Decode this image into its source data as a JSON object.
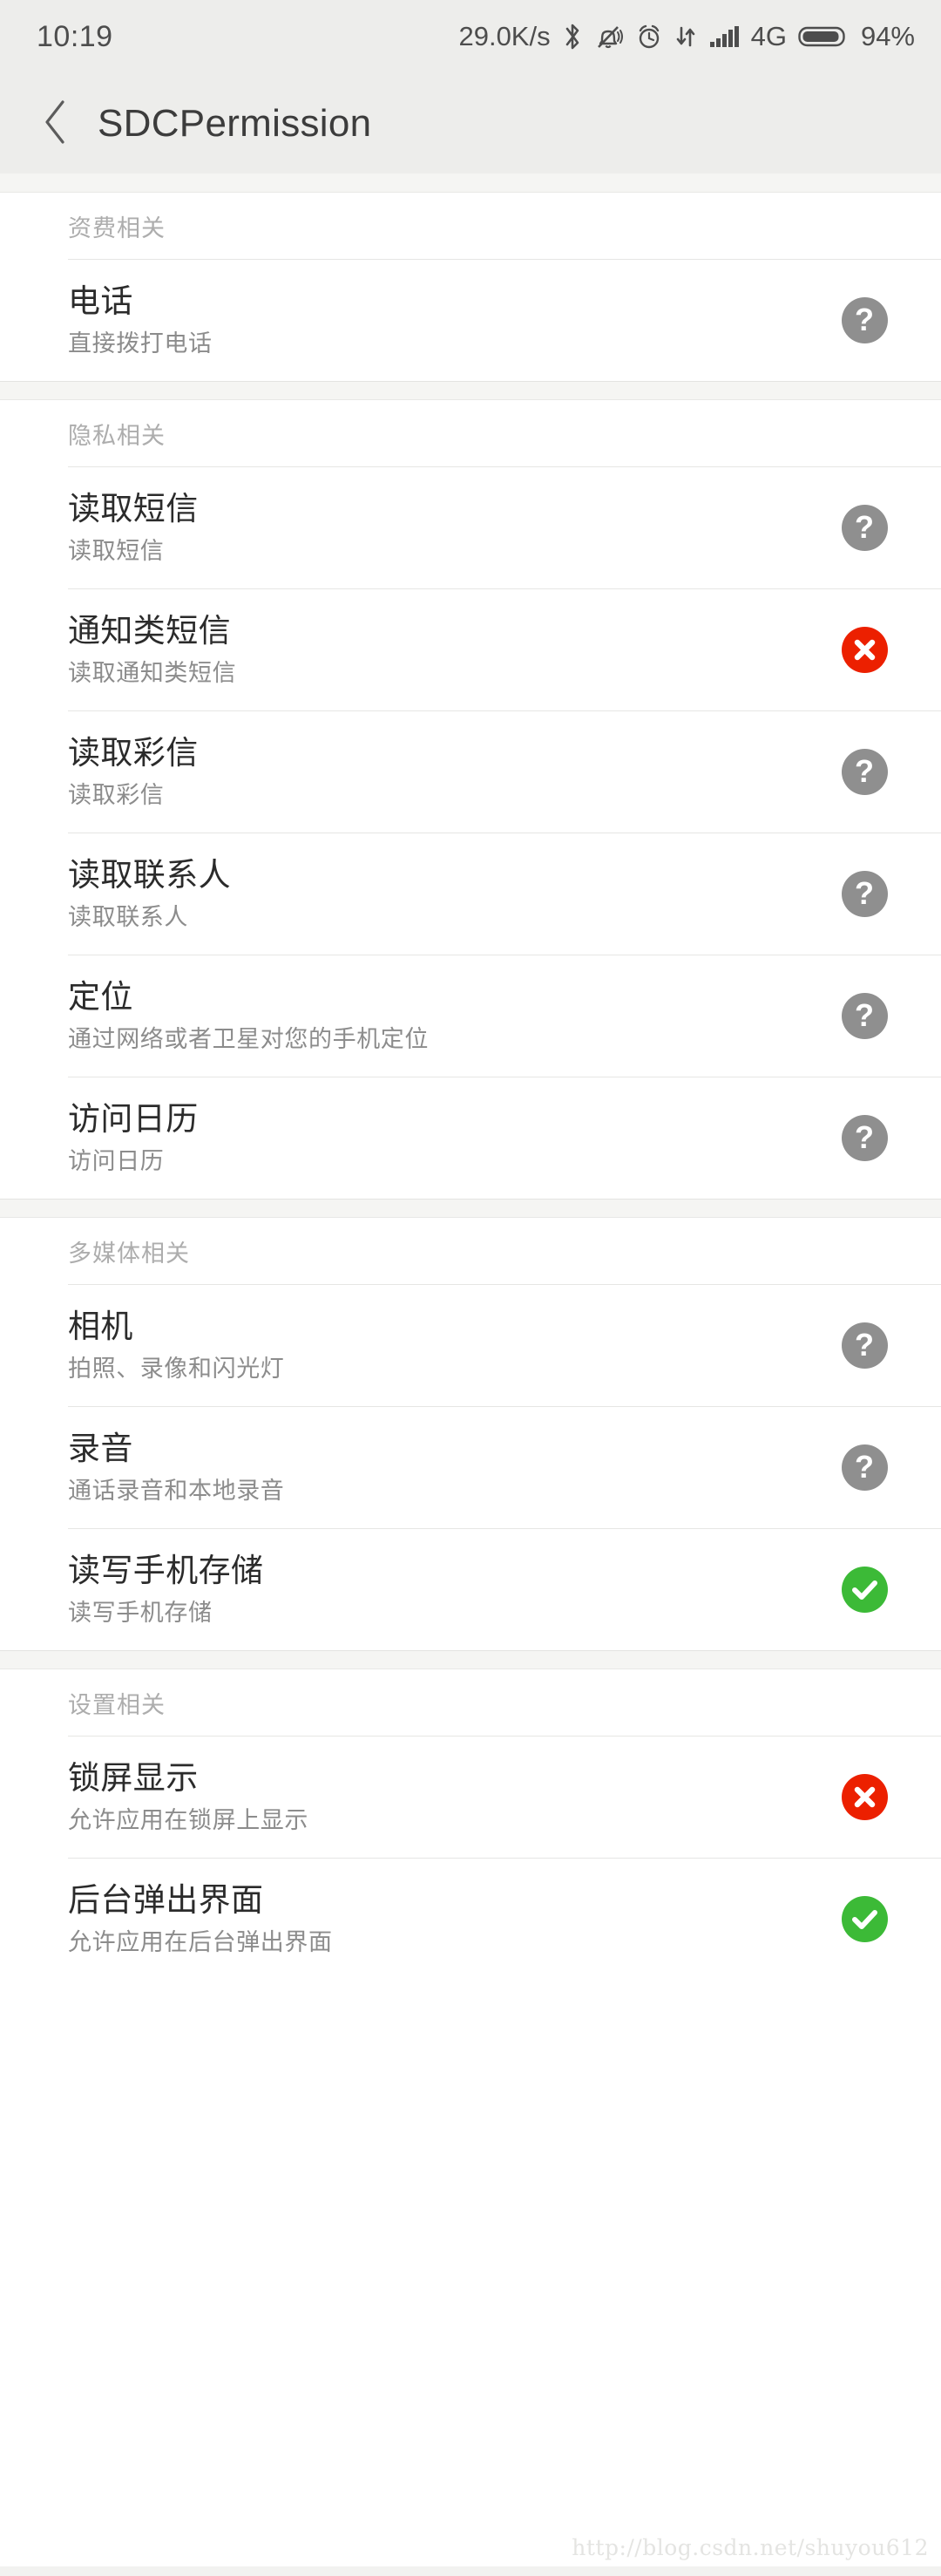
{
  "status_bar": {
    "time": "10:19",
    "net_speed": "29.0K/s",
    "network_type": "4G",
    "battery_percent": "94%",
    "icons": [
      "bluetooth-icon",
      "mute-bell-icon",
      "alarm-clock-icon",
      "data-transfer-icon",
      "signal-bars-icon",
      "battery-icon"
    ]
  },
  "header": {
    "back_icon": "chevron-left-icon",
    "title": "SDCPermission"
  },
  "status_colors": {
    "ask": "#8f8f8f",
    "deny": "#ec2000",
    "allow": "#3cba37"
  },
  "sections": [
    {
      "label": "资费相关",
      "items": [
        {
          "title": "电话",
          "subtitle": "直接拨打电话",
          "state": "ask",
          "state_icon": "question-mark-icon"
        }
      ]
    },
    {
      "label": "隐私相关",
      "items": [
        {
          "title": "读取短信",
          "subtitle": "读取短信",
          "state": "ask",
          "state_icon": "question-mark-icon"
        },
        {
          "title": "通知类短信",
          "subtitle": "读取通知类短信",
          "state": "deny",
          "state_icon": "cross-icon"
        },
        {
          "title": "读取彩信",
          "subtitle": "读取彩信",
          "state": "ask",
          "state_icon": "question-mark-icon"
        },
        {
          "title": "读取联系人",
          "subtitle": "读取联系人",
          "state": "ask",
          "state_icon": "question-mark-icon"
        },
        {
          "title": "定位",
          "subtitle": "通过网络或者卫星对您的手机定位",
          "state": "ask",
          "state_icon": "question-mark-icon"
        },
        {
          "title": "访问日历",
          "subtitle": "访问日历",
          "state": "ask",
          "state_icon": "question-mark-icon"
        }
      ]
    },
    {
      "label": "多媒体相关",
      "items": [
        {
          "title": "相机",
          "subtitle": "拍照、录像和闪光灯",
          "state": "ask",
          "state_icon": "question-mark-icon"
        },
        {
          "title": "录音",
          "subtitle": "通话录音和本地录音",
          "state": "ask",
          "state_icon": "question-mark-icon"
        },
        {
          "title": "读写手机存储",
          "subtitle": "读写手机存储",
          "state": "allow",
          "state_icon": "check-icon"
        }
      ]
    },
    {
      "label": "设置相关",
      "items": [
        {
          "title": "锁屏显示",
          "subtitle": "允许应用在锁屏上显示",
          "state": "deny",
          "state_icon": "cross-icon"
        },
        {
          "title": "后台弹出界面",
          "subtitle": "允许应用在后台弹出界面",
          "state": "allow",
          "state_icon": "check-icon"
        }
      ]
    }
  ],
  "watermark": "http://blog.csdn.net/shuyou612"
}
